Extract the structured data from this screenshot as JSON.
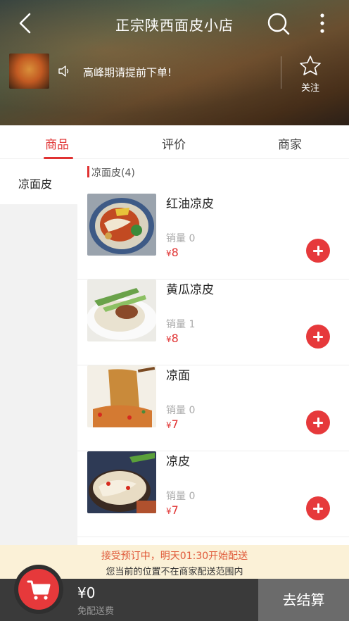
{
  "header": {
    "store_title": "正宗陕西面皮小店",
    "notice": "高峰期请提前下单!",
    "follow_label": "关注"
  },
  "tabs": [
    {
      "label": "商品",
      "active": true
    },
    {
      "label": "评价",
      "active": false
    },
    {
      "label": "商家",
      "active": false
    }
  ],
  "sidebar": {
    "categories": [
      {
        "label": "凉面皮",
        "selected": true
      }
    ]
  },
  "list": {
    "section_title": "凉面皮(4)",
    "products": [
      {
        "name": "红油凉皮",
        "sales": "销量 0",
        "price": "8",
        "image": "red-oil-liangpi-photo"
      },
      {
        "name": "黄瓜凉皮",
        "sales": "销量 1",
        "price": "8",
        "image": "cucumber-liangpi-photo"
      },
      {
        "name": "凉面",
        "sales": "销量 0",
        "price": "7",
        "image": "cold-noodles-photo"
      },
      {
        "name": "凉皮",
        "sales": "销量 0",
        "price": "7",
        "image": "liangpi-photo"
      }
    ],
    "currency_symbol": "¥"
  },
  "notice_bar": {
    "line1": "接受预订中，明天01:30开始配送",
    "line2": "您当前的位置不在商家配送范围内"
  },
  "bottom": {
    "total": "¥0",
    "delivery_note": "免配送费",
    "checkout_label": "去结算"
  },
  "colors": {
    "accent": "#e03232",
    "add_button": "#e6393b",
    "notice_bg": "#fbf1d7",
    "bottom_bar": "#3a3a3a",
    "checkout_bg": "#6b6b6b"
  }
}
